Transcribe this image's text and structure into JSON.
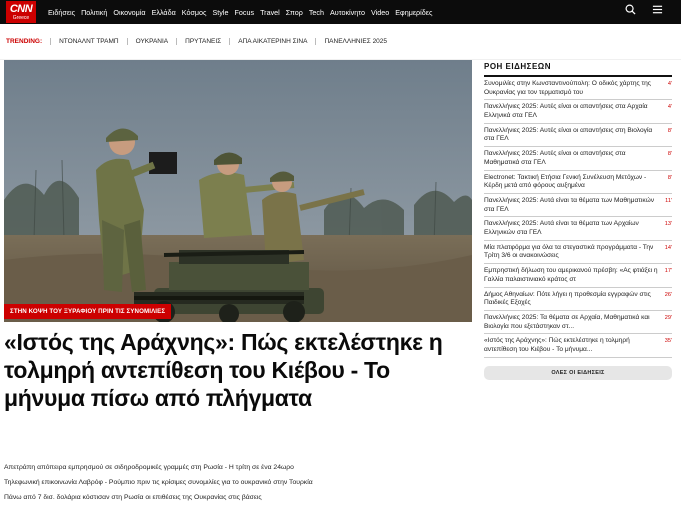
{
  "logo": {
    "brand": "CNN",
    "edition": "Greece"
  },
  "nav": [
    "Ειδήσεις",
    "Πολιτική",
    "Οικονομία",
    "Ελλάδα",
    "Κόσμος",
    "Style",
    "Focus",
    "Travel",
    "Σπορ",
    "Tech",
    "Αυτοκίνητο",
    "Video",
    "Εφημερίδες"
  ],
  "trending": {
    "label": "TRENDING:",
    "items": [
      "ΝΤΟΝΑΛΝΤ ΤΡΑΜΠ",
      "ΟΥΚΡΑΝΙΑ",
      "ΠΡΥΤΑΝΕΙΣ",
      "ΑΠΑ ΑΙΚΑΤΕΡΙΝΗ ΣΙΝΑ",
      "ΠΑΝΕΛΛΗΝΙΕΣ 2025"
    ]
  },
  "hero": {
    "kicker": "ΣΤΗΝ ΚΟΨΗ ΤΟΥ ΞΥΡΑΦΙΟΥ ΠΡΙΝ ΤΙΣ ΣΥΝΟΜΙΛΙΕΣ",
    "headline": "«Ιστός της Αράχνης»: Πώς εκτελέστηκε η τολμηρή αντεπίθεση του Κιέβου - Το μήνυμα πίσω από πλήγματα"
  },
  "related": [
    "Απετράπη απόπειρα εμπρησμού σε σιδηροδρομικές γραμμές στη Ρωσία - Η τρίτη σε ένα 24ωρο",
    "Τηλεφωνική επικοινωνία Λαβρόφ - Ρούμπιο πριν τις κρίσιμες συνομιλίες για το ουκρανικό στην Τουρκία",
    "Πάνω από 7 δισ. δολάρια κόστισαν στη Ρωσία οι επιθέσεις της Ουκρανίας στις βάσεις"
  ],
  "sidebar": {
    "title": "ΡΟΗ ΕΙΔΗΣΕΩΝ",
    "items": [
      {
        "text": "Συνομιλίες στην Κωνσταντινούπολη: Ο οδικός χάρτης της Ουκρανίας για τον τερματισμό του",
        "time": "4'"
      },
      {
        "text": "Πανελλήνιες 2025: Αυτές είναι οι απαντήσεις στα Αρχαία Ελληνικά στα ΓΕΛ",
        "time": "4'"
      },
      {
        "text": "Πανελλήνιες 2025: Αυτές είναι οι απαντήσεις στη Βιολογία στα ΓΕΛ",
        "time": "8'"
      },
      {
        "text": "Πανελλήνιες 2025: Αυτές είναι οι απαντήσεις στα Μαθηματικά στα ΓΕΛ",
        "time": "8'"
      },
      {
        "text": "Electronet: Τακτική Ετήσια Γενική Συνέλευση Μετόχων - Κέρδη μετά από φόρους αυξημένα",
        "time": "8'"
      },
      {
        "text": "Πανελλήνιες 2025: Αυτά είναι τα θέματα των Μαθηματικών στα ΓΕΛ",
        "time": "11'"
      },
      {
        "text": "Πανελλήνιες 2025: Αυτά είναι τα θέματα των Αρχαίων Ελληνικών στα ΓΕΛ",
        "time": "13'"
      },
      {
        "text": "Μία πλατφόρμα για όλα τα στεγαστικά προγράμματα - Την Τρίτη 3/6 οι ανακοινώσεις",
        "time": "14'"
      },
      {
        "text": "Εμπρηστική δήλωση του αμερικανού πρέσβη: «Ας φτιάξει η Γαλλία παλαιστινιακό κράτος στ",
        "time": "17'"
      },
      {
        "text": "Δήμος Αθηναίων: Πότε λήγει η προθεσμία εγγραφών στις Παιδικές Εξοχές",
        "time": "26'"
      },
      {
        "text": "Πανελλήνιες 2025: Τα θέματα σε Αρχαία, Μαθηματικά και Βιολογία που εξετάστηκαν στ...",
        "time": "29'"
      },
      {
        "text": "«Ιστός της Αράχνης»: Πώς εκτελέστηκε η τολμηρή αντεπίθεση του Κιέβου - Το μήνυμα...",
        "time": "35'"
      }
    ],
    "all_label": "ΟΛΕΣ ΟΙ ΕΙΔΗΣΕΙΣ"
  }
}
